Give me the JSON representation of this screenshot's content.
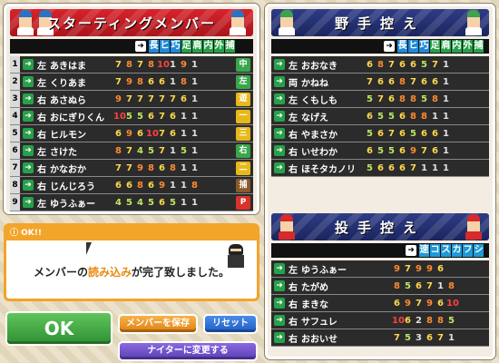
{
  "lineup": {
    "title": "スターティングメンバー",
    "cols": [
      "長",
      "ヒ",
      "巧",
      "足",
      "肩",
      "内",
      "外",
      "捕"
    ],
    "col_colors": [
      "#1e8ad8",
      "#1e8ad8",
      "#1e8ad8",
      "#27a04a",
      "#27a04a",
      "#27a04a",
      "#27a04a",
      "#27a04a"
    ],
    "players": [
      {
        "n": "1",
        "hand": "左",
        "name": "あきはま",
        "stats": [
          "7",
          "8",
          "7",
          "8",
          "10",
          "1",
          "9",
          "1"
        ],
        "pos": "中",
        "pc": "#3aa64b"
      },
      {
        "n": "2",
        "hand": "左",
        "name": "くりあま",
        "stats": [
          "7",
          "9",
          "8",
          "6",
          "6",
          "1",
          "8",
          "1"
        ],
        "pos": "左",
        "pc": "#3aa64b"
      },
      {
        "n": "3",
        "hand": "右",
        "name": "あさぬら",
        "stats": [
          "9",
          "7",
          "7",
          "7",
          "7",
          "7",
          "6",
          "1"
        ],
        "pos": "遊",
        "pc": "#e8b81a"
      },
      {
        "n": "4",
        "hand": "右",
        "name": "おにぎりくん",
        "stats": [
          "10",
          "5",
          "5",
          "6",
          "7",
          "6",
          "1",
          "1"
        ],
        "pos": "一",
        "pc": "#e8b81a"
      },
      {
        "n": "5",
        "hand": "右",
        "name": "ヒルモン",
        "stats": [
          "6",
          "9",
          "6",
          "10",
          "7",
          "6",
          "1",
          "1"
        ],
        "pos": "三",
        "pc": "#e8b81a"
      },
      {
        "n": "6",
        "hand": "左",
        "name": "さけた",
        "stats": [
          "8",
          "7",
          "4",
          "5",
          "7",
          "1",
          "5",
          "1"
        ],
        "pos": "右",
        "pc": "#3aa64b"
      },
      {
        "n": "7",
        "hand": "右",
        "name": "かなおか",
        "stats": [
          "7",
          "7",
          "9",
          "8",
          "6",
          "8",
          "1",
          "1"
        ],
        "pos": "二",
        "pc": "#e8b81a"
      },
      {
        "n": "8",
        "hand": "右",
        "name": "じんじろう",
        "stats": [
          "6",
          "6",
          "8",
          "6",
          "9",
          "1",
          "1",
          "8"
        ],
        "pos": "捕",
        "pc": "#8a5a2a"
      },
      {
        "n": "9",
        "hand": "左",
        "name": "ゆうふぁー",
        "stats": [
          "4",
          "5",
          "4",
          "5",
          "6",
          "5",
          "1",
          "1"
        ],
        "pos": "P",
        "pc": "#d8322a"
      }
    ]
  },
  "fielders": {
    "title": "野手控え",
    "cols": [
      "長",
      "ヒ",
      "巧",
      "足",
      "肩",
      "内",
      "外",
      "捕"
    ],
    "players": [
      {
        "hand": "左",
        "name": "おおなき",
        "stats": [
          "6",
          "8",
          "7",
          "6",
          "6",
          "5",
          "7",
          "1"
        ]
      },
      {
        "hand": "両",
        "name": "かねね",
        "stats": [
          "7",
          "6",
          "6",
          "8",
          "7",
          "6",
          "6",
          "1"
        ]
      },
      {
        "hand": "左",
        "name": "くもしも",
        "stats": [
          "5",
          "7",
          "6",
          "8",
          "8",
          "5",
          "8",
          "1"
        ]
      },
      {
        "hand": "左",
        "name": "なげえ",
        "stats": [
          "6",
          "5",
          "5",
          "6",
          "8",
          "8",
          "1",
          "1"
        ]
      },
      {
        "hand": "右",
        "name": "やまさか",
        "stats": [
          "5",
          "6",
          "7",
          "6",
          "5",
          "6",
          "6",
          "1"
        ]
      },
      {
        "hand": "右",
        "name": "いせわか",
        "stats": [
          "6",
          "5",
          "5",
          "6",
          "9",
          "7",
          "6",
          "1"
        ]
      },
      {
        "hand": "右",
        "name": "ほそタカノリ",
        "stats": [
          "5",
          "6",
          "6",
          "6",
          "7",
          "1",
          "1",
          "1"
        ]
      }
    ]
  },
  "pitchers": {
    "title": "投手控え",
    "cols": [
      "速",
      "コ",
      "ス",
      "カ",
      "フ",
      "シ"
    ],
    "players": [
      {
        "hand": "左",
        "name": "ゆうふぁー",
        "stats": [
          "9",
          "7",
          "9",
          "9",
          "6",
          ""
        ]
      },
      {
        "hand": "右",
        "name": "たがめ",
        "stats": [
          "8",
          "5",
          "6",
          "7",
          "1",
          "8"
        ]
      },
      {
        "hand": "右",
        "name": "まきな",
        "stats": [
          "6",
          "9",
          "7",
          "9",
          "6",
          "10"
        ]
      },
      {
        "hand": "右",
        "name": "サフュレ",
        "stats": [
          "10",
          "6",
          "2",
          "8",
          "8",
          "5"
        ]
      },
      {
        "hand": "右",
        "name": "おおいせ",
        "stats": [
          "7",
          "5",
          "3",
          "6",
          "7",
          "1"
        ]
      }
    ]
  },
  "message": {
    "tag": "OK!!",
    "pre": "メンバーの",
    "hl": "読み込み",
    "post": "が完了致しました。"
  },
  "buttons": {
    "ok": "OK",
    "save": "メンバーを保存",
    "reset": "リセット",
    "night": "ナイターに変更する"
  },
  "colors": {
    "red": "#d81f26",
    "navy": "#1b255f",
    "green": "#3aa64b",
    "orange": "#f3a42a",
    "blue": "#2f6fd8",
    "purple": "#6b4fc4"
  }
}
